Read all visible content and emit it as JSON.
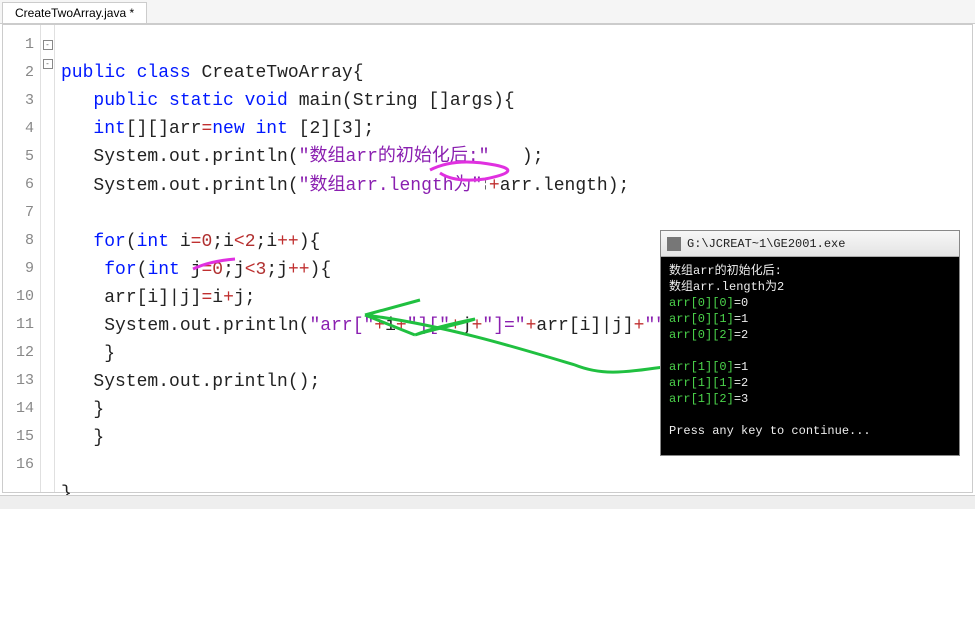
{
  "tab": {
    "label": "CreateTwoArray.java *"
  },
  "lines": [
    "1",
    "2",
    "3",
    "4",
    "5",
    "6",
    "7",
    "8",
    "9",
    "10",
    "11",
    "12",
    "13",
    "14",
    "15",
    "16"
  ],
  "code": {
    "l1": {
      "kw1": "public",
      "kw2": "class",
      "name": "CreateTwoArray",
      "brace": "{"
    },
    "l2": {
      "kw1": "public",
      "kw2": "static",
      "kw3": "void",
      "mname": "main",
      "sig": "(String []args){"
    },
    "l3": {
      "t1": "int",
      "t2": "[][]arr",
      "op": "=",
      "kw": "new",
      "t3": "int",
      "dims": " [2][3];"
    },
    "l4": {
      "pre": "System.out.",
      "m": "println",
      "open": "(",
      "str": "\"数组arr的初始化后:\"",
      "close": "   );"
    },
    "l5": {
      "pre": "System.out.",
      "m": "println",
      "open": "(",
      "str": "\"数组arr.length为\"",
      "plus": "+",
      "expr": "arr.length);"
    },
    "l7": {
      "kw": "for",
      "open": "(",
      "t": "int",
      "v": " i",
      "eq": "=",
      "z": "0",
      ";i": ";",
      "lt": "<",
      "two": "2",
      ";i2": ";i",
      "pp": "++",
      "close": "){"
    },
    "l8": {
      "kw": "for",
      "open": "(",
      "t": "int",
      "v": " j",
      "eq": "=",
      "z": "0",
      ";j": ";",
      "lt": "<",
      "three": "3",
      ";j2": ";j",
      "pp": "++",
      "close": "){"
    },
    "l9": {
      "a": "arr[i]|j]",
      "eq": "=",
      "expr": "i",
      "plus": "+",
      "j": "j;"
    },
    "l10": {
      "pre": "System.out.",
      "m": "println",
      "open": "(",
      "s1": "\"arr[\"",
      "p1": "+",
      "e1": "i",
      "p2": "+",
      "s2": "\"][\"",
      "p3": "+",
      "e2": "j",
      "p4": "+",
      "s3": "\"]=\"",
      "p5": "+",
      "e3": "arr[i]|j]",
      "p6": "+",
      "s4": "\"\"",
      "close": ");"
    },
    "l11": {
      "brace": "}"
    },
    "l12": {
      "pre": "System.out.",
      "m": "println",
      "rest": "();"
    },
    "l13": {
      "brace": "}"
    },
    "l14": {
      "brace": "}"
    },
    "l16": {
      "brace": "}"
    }
  },
  "console": {
    "title": "G:\\JCREAT~1\\GE2001.exe",
    "lines": [
      "数组arr的初始化后:",
      "数组arr.length为2",
      "arr[0][0]=0",
      "arr[0][1]=1",
      "arr[0][2]=2",
      "",
      "arr[1][0]=1",
      "arr[1][1]=2",
      "arr[1][2]=3",
      "",
      "Press any key to continue..."
    ]
  }
}
